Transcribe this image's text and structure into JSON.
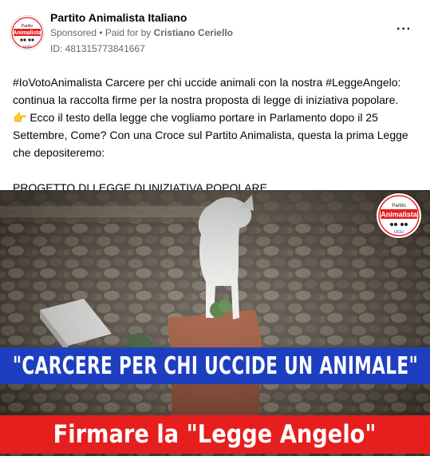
{
  "post": {
    "page_name": "Partito Animalista Italiano",
    "sponsored": "Sponsored",
    "separator": " • ",
    "paid_prefix": "Paid for by ",
    "payer": "Cristiano Ceriello",
    "ad_id": "ID: 481315773841667",
    "more_icon": "more-horizontal-icon"
  },
  "logo": {
    "line1": "Partito",
    "line2": "Animalista",
    "line3": "UCEI"
  },
  "body_text": {
    "line1": "#IoVotoAnimalista Carcere per chi uccide animali con la nostra #LeggeAngelo:",
    "line2": "continua la raccolta firme per la nostra proposta di legge di iniziativa popolare.",
    "line3": "👉 Ecco il testo della legge che vogliamo portare in Parlamento dopo il 25",
    "line4": "Settembre, Come? Con una Croce sul Partito Animalista, questa la prima Legge",
    "line5": "che depositeremo:",
    "line6": "PROGETTO DI LEGGE DI INIZIATIVA POPOLARE…"
  },
  "media": {
    "headline": "\"CARCERE PER CHI UCCIDE UN ANIMALE\"",
    "subheadline": "Firmare la \"Legge Angelo\"",
    "colors": {
      "blue_banner": "#1d3fbf",
      "red_banner": "#e61e1e"
    }
  }
}
